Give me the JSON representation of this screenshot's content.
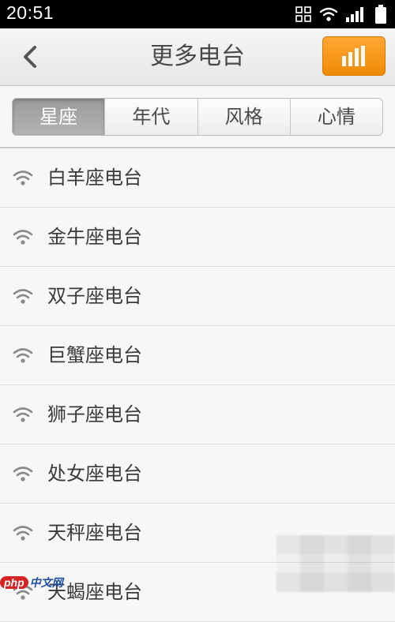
{
  "status_bar": {
    "time": "20:51",
    "icons": [
      "grid-icon",
      "wifi-icon",
      "signal-icon",
      "battery-icon"
    ]
  },
  "header": {
    "title": "更多电台",
    "back_icon": "chevron-left-icon",
    "now_playing_icon": "equalizer-bars-icon",
    "accent": "#f59a14"
  },
  "tabs": [
    {
      "label": "星座",
      "active": true
    },
    {
      "label": "年代",
      "active": false
    },
    {
      "label": "风格",
      "active": false
    },
    {
      "label": "心情",
      "active": false
    }
  ],
  "stations": [
    {
      "label": "白羊座电台",
      "icon": "radio-signal-icon"
    },
    {
      "label": "金牛座电台",
      "icon": "radio-signal-icon"
    },
    {
      "label": "双子座电台",
      "icon": "radio-signal-icon"
    },
    {
      "label": "巨蟹座电台",
      "icon": "radio-signal-icon"
    },
    {
      "label": "狮子座电台",
      "icon": "radio-signal-icon"
    },
    {
      "label": "处女座电台",
      "icon": "radio-signal-icon"
    },
    {
      "label": "天秤座电台",
      "icon": "radio-signal-icon"
    },
    {
      "label": "天蝎座电台",
      "icon": "radio-signal-icon"
    }
  ],
  "watermark": {
    "brand": "php",
    "suffix": "中文网"
  }
}
